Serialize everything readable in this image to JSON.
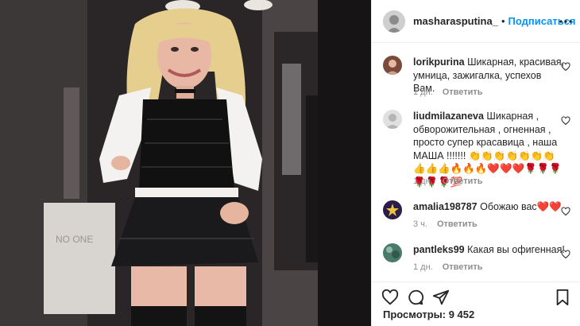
{
  "post": {
    "username": "masharasputina_",
    "separator": "•",
    "follow_label": "Подписаться",
    "more_icon": "more-horizontal-icon"
  },
  "video": {
    "watermark": "NO ONE"
  },
  "comments": [
    {
      "username": "lorikpurina",
      "text": "Шикарная, красивая, умница, зажигалка, успехов Вам.",
      "time": "1 дн.",
      "reply": "Ответить",
      "avatar_color": "#7a4a3a"
    },
    {
      "username": "liudmilazaneva",
      "text": "Шикарная , обворожительная , огненная , просто супер красавица , наша МАША !!!!!!! 👏👏👏👏👏👏👏👍👍👍🔥🔥🔥❤️❤️❤️🌹🌹🌹🌹🌹🌹💯",
      "time": "1 дн.",
      "reply": "Ответить",
      "avatar_color": "#d0d0d0"
    },
    {
      "username": "amalia198787",
      "text": "Обожаю вас❤️❤️",
      "time": "3 ч.",
      "reply": "Ответить",
      "avatar_color": "#2b1d4a"
    },
    {
      "username": "pantleks99",
      "text": "Какая вы офигенная!",
      "time": "1 дн.",
      "reply": "Ответить",
      "avatar_color": "#4a7a6a"
    }
  ],
  "actions": {
    "icons": [
      "heart-icon",
      "comment-icon",
      "share-icon",
      "bookmark-icon"
    ],
    "views_label": "Просмотры:",
    "views_count": "9 452"
  },
  "colors": {
    "accent": "#0095f6",
    "text": "#262626",
    "muted": "#8e8e8e",
    "divider": "#efefef"
  }
}
